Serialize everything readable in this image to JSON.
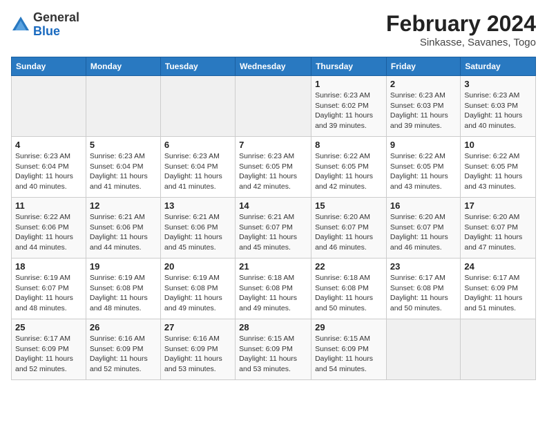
{
  "header": {
    "logo_general": "General",
    "logo_blue": "Blue",
    "month_year": "February 2024",
    "location": "Sinkasse, Savanes, Togo"
  },
  "days_of_week": [
    "Sunday",
    "Monday",
    "Tuesday",
    "Wednesday",
    "Thursday",
    "Friday",
    "Saturday"
  ],
  "weeks": [
    [
      {
        "day": "",
        "detail": ""
      },
      {
        "day": "",
        "detail": ""
      },
      {
        "day": "",
        "detail": ""
      },
      {
        "day": "",
        "detail": ""
      },
      {
        "day": "1",
        "detail": "Sunrise: 6:23 AM\nSunset: 6:02 PM\nDaylight: 11 hours and 39 minutes."
      },
      {
        "day": "2",
        "detail": "Sunrise: 6:23 AM\nSunset: 6:03 PM\nDaylight: 11 hours and 39 minutes."
      },
      {
        "day": "3",
        "detail": "Sunrise: 6:23 AM\nSunset: 6:03 PM\nDaylight: 11 hours and 40 minutes."
      }
    ],
    [
      {
        "day": "4",
        "detail": "Sunrise: 6:23 AM\nSunset: 6:04 PM\nDaylight: 11 hours and 40 minutes."
      },
      {
        "day": "5",
        "detail": "Sunrise: 6:23 AM\nSunset: 6:04 PM\nDaylight: 11 hours and 41 minutes."
      },
      {
        "day": "6",
        "detail": "Sunrise: 6:23 AM\nSunset: 6:04 PM\nDaylight: 11 hours and 41 minutes."
      },
      {
        "day": "7",
        "detail": "Sunrise: 6:23 AM\nSunset: 6:05 PM\nDaylight: 11 hours and 42 minutes."
      },
      {
        "day": "8",
        "detail": "Sunrise: 6:22 AM\nSunset: 6:05 PM\nDaylight: 11 hours and 42 minutes."
      },
      {
        "day": "9",
        "detail": "Sunrise: 6:22 AM\nSunset: 6:05 PM\nDaylight: 11 hours and 43 minutes."
      },
      {
        "day": "10",
        "detail": "Sunrise: 6:22 AM\nSunset: 6:05 PM\nDaylight: 11 hours and 43 minutes."
      }
    ],
    [
      {
        "day": "11",
        "detail": "Sunrise: 6:22 AM\nSunset: 6:06 PM\nDaylight: 11 hours and 44 minutes."
      },
      {
        "day": "12",
        "detail": "Sunrise: 6:21 AM\nSunset: 6:06 PM\nDaylight: 11 hours and 44 minutes."
      },
      {
        "day": "13",
        "detail": "Sunrise: 6:21 AM\nSunset: 6:06 PM\nDaylight: 11 hours and 45 minutes."
      },
      {
        "day": "14",
        "detail": "Sunrise: 6:21 AM\nSunset: 6:07 PM\nDaylight: 11 hours and 45 minutes."
      },
      {
        "day": "15",
        "detail": "Sunrise: 6:20 AM\nSunset: 6:07 PM\nDaylight: 11 hours and 46 minutes."
      },
      {
        "day": "16",
        "detail": "Sunrise: 6:20 AM\nSunset: 6:07 PM\nDaylight: 11 hours and 46 minutes."
      },
      {
        "day": "17",
        "detail": "Sunrise: 6:20 AM\nSunset: 6:07 PM\nDaylight: 11 hours and 47 minutes."
      }
    ],
    [
      {
        "day": "18",
        "detail": "Sunrise: 6:19 AM\nSunset: 6:07 PM\nDaylight: 11 hours and 48 minutes."
      },
      {
        "day": "19",
        "detail": "Sunrise: 6:19 AM\nSunset: 6:08 PM\nDaylight: 11 hours and 48 minutes."
      },
      {
        "day": "20",
        "detail": "Sunrise: 6:19 AM\nSunset: 6:08 PM\nDaylight: 11 hours and 49 minutes."
      },
      {
        "day": "21",
        "detail": "Sunrise: 6:18 AM\nSunset: 6:08 PM\nDaylight: 11 hours and 49 minutes."
      },
      {
        "day": "22",
        "detail": "Sunrise: 6:18 AM\nSunset: 6:08 PM\nDaylight: 11 hours and 50 minutes."
      },
      {
        "day": "23",
        "detail": "Sunrise: 6:17 AM\nSunset: 6:08 PM\nDaylight: 11 hours and 50 minutes."
      },
      {
        "day": "24",
        "detail": "Sunrise: 6:17 AM\nSunset: 6:09 PM\nDaylight: 11 hours and 51 minutes."
      }
    ],
    [
      {
        "day": "25",
        "detail": "Sunrise: 6:17 AM\nSunset: 6:09 PM\nDaylight: 11 hours and 52 minutes."
      },
      {
        "day": "26",
        "detail": "Sunrise: 6:16 AM\nSunset: 6:09 PM\nDaylight: 11 hours and 52 minutes."
      },
      {
        "day": "27",
        "detail": "Sunrise: 6:16 AM\nSunset: 6:09 PM\nDaylight: 11 hours and 53 minutes."
      },
      {
        "day": "28",
        "detail": "Sunrise: 6:15 AM\nSunset: 6:09 PM\nDaylight: 11 hours and 53 minutes."
      },
      {
        "day": "29",
        "detail": "Sunrise: 6:15 AM\nSunset: 6:09 PM\nDaylight: 11 hours and 54 minutes."
      },
      {
        "day": "",
        "detail": ""
      },
      {
        "day": "",
        "detail": ""
      }
    ]
  ]
}
